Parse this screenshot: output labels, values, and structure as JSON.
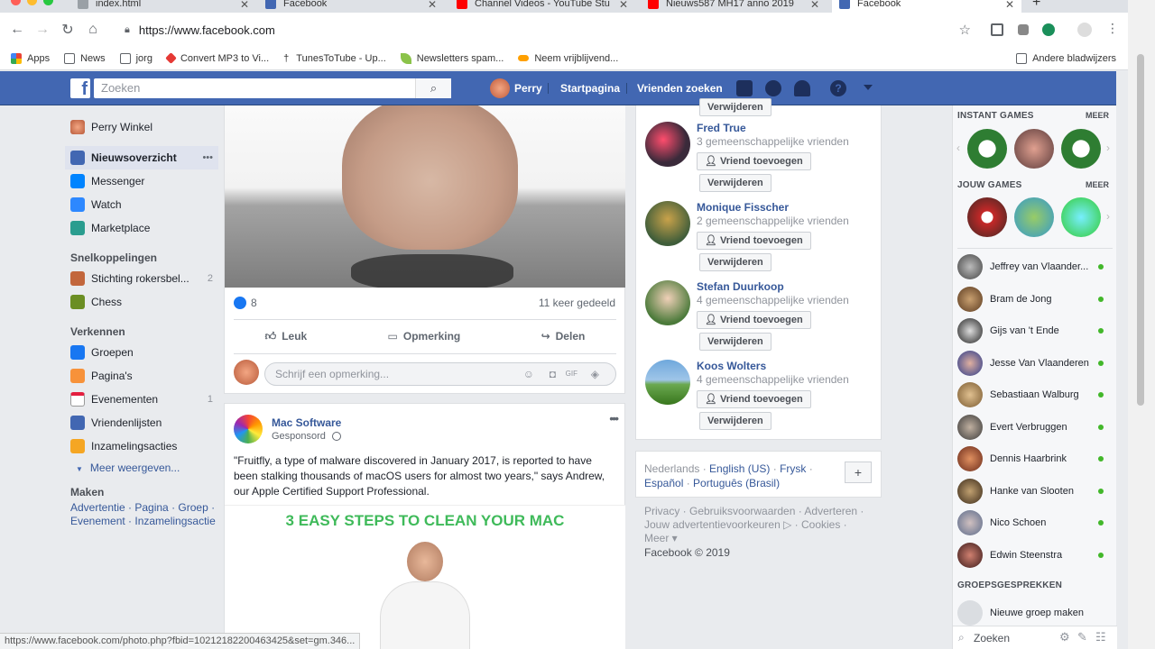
{
  "browser": {
    "tabs": [
      {
        "title": "index.html",
        "icon": "document-icon",
        "color": "#9aa0a6"
      },
      {
        "title": "Facebook",
        "icon": "facebook-icon",
        "color": "#4267b2"
      },
      {
        "title": "Channel Videos - YouTube Stu",
        "icon": "youtube-icon",
        "color": "#ff0000"
      },
      {
        "title": "Nieuws587 MH17 anno 2019",
        "icon": "youtube-icon",
        "color": "#ff0000"
      },
      {
        "title": "Facebook",
        "icon": "facebook-icon",
        "color": "#4267b2"
      }
    ],
    "url": "https://www.facebook.com",
    "bookmarks": [
      {
        "label": "Apps",
        "icon": "apps-grid-icon"
      },
      {
        "label": "News",
        "icon": "folder-icon"
      },
      {
        "label": "jorg",
        "icon": "folder-icon"
      },
      {
        "label": "Convert MP3 to Vi...",
        "icon": "convert-icon"
      },
      {
        "label": "TunesToTube - Up...",
        "icon": "pin-icon"
      },
      {
        "label": "Newsletters spam...",
        "icon": "leaf-icon"
      },
      {
        "label": "Neem vrijblijvend...",
        "icon": "link-icon"
      }
    ],
    "other_bookmarks": "Andere bladwijzers",
    "status_url": "https://www.facebook.com/photo.php?fbid=10212182200463425&set=gm.346..."
  },
  "header": {
    "search_placeholder": "Zoeken",
    "user_name": "Perry",
    "home": "Startpagina",
    "find_friends": "Vrienden zoeken"
  },
  "leftnav": {
    "profile": "Perry Winkel",
    "main": [
      {
        "label": "Nieuwsoverzicht",
        "more": "•••"
      },
      {
        "label": "Messenger"
      },
      {
        "label": "Watch"
      },
      {
        "label": "Marketplace"
      }
    ],
    "shortcuts_title": "Snelkoppelingen",
    "shortcuts": [
      {
        "label": "Stichting rokersbel...",
        "count": "2"
      },
      {
        "label": "Chess"
      }
    ],
    "explore_title": "Verkennen",
    "explore": [
      {
        "label": "Groepen"
      },
      {
        "label": "Pagina's"
      },
      {
        "label": "Evenementen",
        "count": "1"
      },
      {
        "label": "Vriendenlijsten"
      },
      {
        "label": "Inzamelingsacties"
      }
    ],
    "more": "Meer weergeven...",
    "create_title": "Maken",
    "create_links_1": "Advertentie · Pagina · Groep ·",
    "create_links_2": "Evenement · Inzamelingsactie"
  },
  "post1": {
    "likes": "8",
    "shares": "11 keer gedeeld",
    "like": "Leuk",
    "comment": "Opmerking",
    "share": "Delen",
    "comment_placeholder": "Schrijf een opmerking..."
  },
  "post2": {
    "author": "Mac Software",
    "sponsored": "Gesponsord",
    "text": "\"Fruitfly, a type of malware discovered in January 2017, is reported to have been stalking thousands of macOS users for almost two years,\" says Andrew, our Apple Certified Support Professional.",
    "banner": "3 EASY STEPS TO CLEAN YOUR MAC"
  },
  "pymk": {
    "top_cut": "Verwijderen",
    "people": [
      {
        "name": "Fred True",
        "mutual": "3 gemeenschappelijke vrienden"
      },
      {
        "name": "Monique Fisscher",
        "mutual": "2 gemeenschappelijke vrienden"
      },
      {
        "name": "Stefan Duurkoop",
        "mutual": "4 gemeenschappelijke vrienden"
      },
      {
        "name": "Koos Wolters",
        "mutual": "4 gemeenschappelijke vrienden"
      }
    ],
    "add": "Vriend toevoegen",
    "remove": "Verwijderen"
  },
  "languages": {
    "current": "Nederlands",
    "others": [
      "English (US)",
      "Frysk",
      "Español",
      "Português (Brasil)"
    ],
    "add": "+"
  },
  "footer": {
    "line1": "Privacy · Gebruiksvoorwaarden · Adverteren ·",
    "line2": "Jouw advertentievoorkeuren ▷ · Cookies ·",
    "line3": "Meer ▾",
    "copyright": "Facebook © 2019"
  },
  "rail": {
    "instant_games": "INSTANT GAMES",
    "your_games": "JOUW GAMES",
    "more": "MEER",
    "contacts": [
      "Jeffrey van Vlaander...",
      "Bram de Jong",
      "Gijs van 't Ende",
      "Jesse Van Vlaanderen",
      "Sebastiaan Walburg",
      "Evert Verbruggen",
      "Dennis Haarbrink",
      "Hanke van Slooten",
      "Nico Schoen",
      "Edwin Steenstra"
    ],
    "group_chats": "GROEPSGESPREKKEN",
    "new_group": "Nieuwe groep maken",
    "search_placeholder": "Zoeken"
  }
}
